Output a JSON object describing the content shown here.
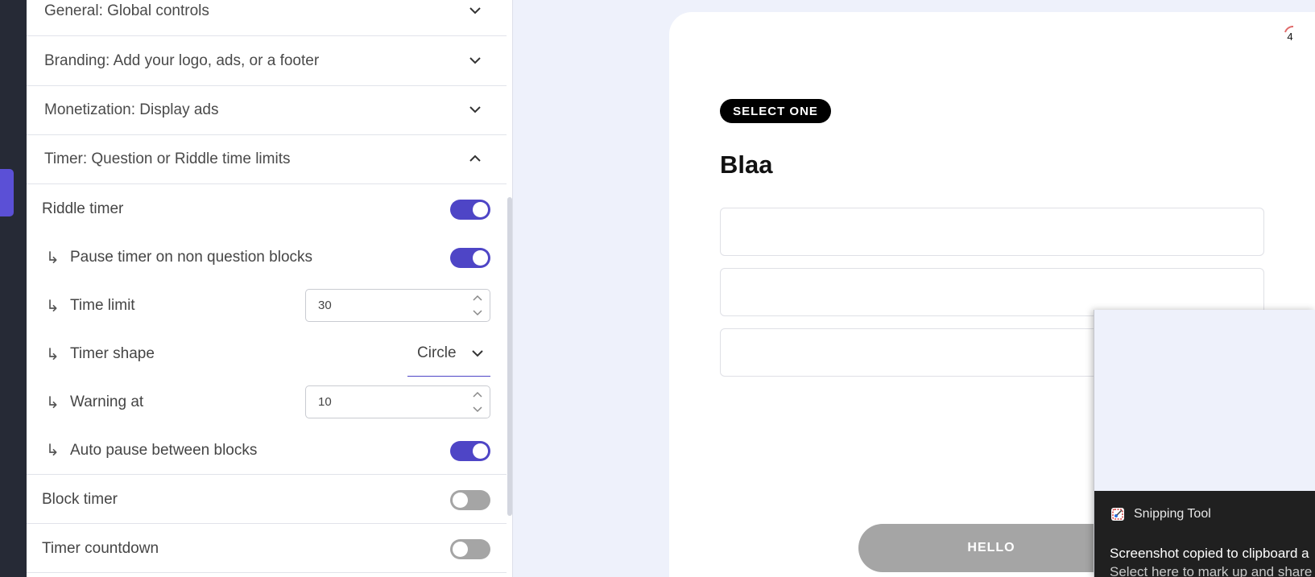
{
  "settings": {
    "sections": [
      {
        "label": "General: Global controls",
        "expanded": false
      },
      {
        "label": "Branding: Add your logo, ads, or a footer",
        "expanded": false
      },
      {
        "label": "Monetization: Display ads",
        "expanded": false
      },
      {
        "label": "Timer: Question or Riddle time limits",
        "expanded": true
      }
    ],
    "timer": {
      "riddle_timer": {
        "label": "Riddle timer",
        "on": true
      },
      "pause_non_question": {
        "label": "Pause timer on non question blocks",
        "on": true
      },
      "time_limit": {
        "label": "Time limit",
        "value": "30"
      },
      "timer_shape": {
        "label": "Timer shape",
        "value": "Circle"
      },
      "warning_at": {
        "label": "Warning at",
        "value": "10"
      },
      "auto_pause": {
        "label": "Auto pause between blocks",
        "on": true
      },
      "block_timer": {
        "label": "Block timer",
        "on": false
      },
      "timer_countdown": {
        "label": "Timer countdown",
        "on": false
      },
      "sub_arrow": "↳"
    }
  },
  "preview": {
    "badge": "SELECT ONE",
    "question": "Blaa",
    "button": "HELLO",
    "timer_value": "4",
    "option_count": 3
  },
  "toast": {
    "app": "Snipping Tool",
    "message": "Screenshot copied to clipboard a",
    "sub": "Select here to mark up and share"
  },
  "colors": {
    "accent": "#4e45c6",
    "sidebar": "#262a36",
    "toggle_off": "#a5a5a5",
    "page_bg": "#eef1fb"
  },
  "icons": {
    "collapsed": "chevron-down-icon",
    "expanded": "chevron-up-icon",
    "toast_app": "snipping-tool-icon"
  }
}
